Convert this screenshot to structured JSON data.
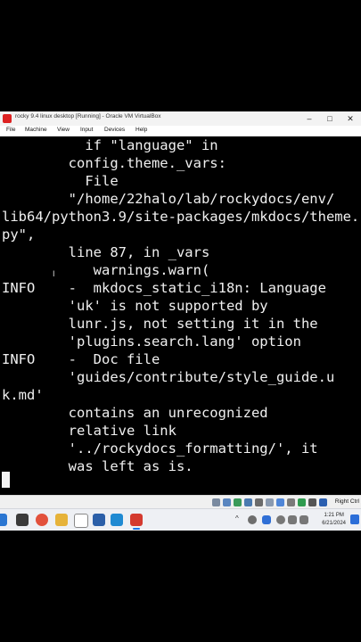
{
  "window": {
    "title": "rocky 9.4 linux desktop [Running] - Oracle VM VirtualBox",
    "minimize_glyph": "–",
    "maximize_glyph": "□",
    "close_glyph": "✕"
  },
  "menu": [
    "File",
    "Machine",
    "View",
    "Input",
    "Devices",
    "Help"
  ],
  "terminal": {
    "lines": [
      "          if \"language\" in",
      "        config.theme._vars:",
      "          File",
      "        \"/home/22halo/lab/rockydocs/env/",
      "lib64/python3.9/site-packages/mkdocs/theme.",
      "py\",",
      "        line 87, in _vars",
      "           warnings.warn(",
      "INFO    -  mkdocs_static_i18n: Language",
      "        'uk' is not supported by",
      "        lunr.js, not setting it in the",
      "        'plugins.search.lang' option",
      "INFO    -  Doc file",
      "        'guides/contribute/style_guide.u",
      "k.md'",
      "        contains an unrecognized",
      "        relative link",
      "        '../rockydocs_formatting/', it",
      "        was left as is."
    ],
    "mouse_glyph": "I"
  },
  "statusbar": {
    "host_key": "Right Ctrl"
  },
  "taskbar": {
    "tray_up": "^",
    "clock_time": "1:21 PM",
    "clock_date": "6/21/2024"
  },
  "colors": {
    "terminal_bg": "#000000",
    "terminal_fg": "#f0f0f0",
    "accent": "#1a73e8"
  }
}
